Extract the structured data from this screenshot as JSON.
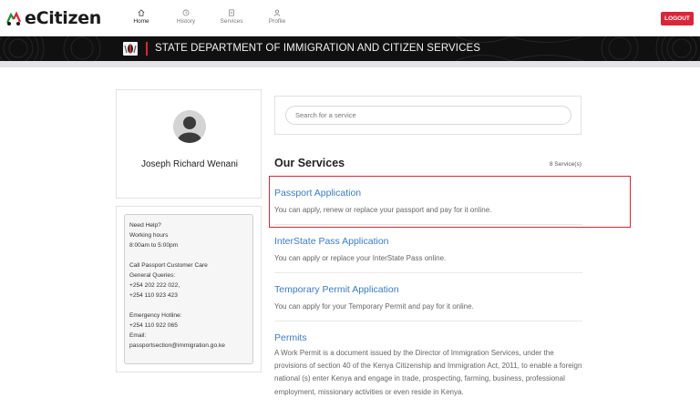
{
  "app": {
    "logo_text": "eCitizen",
    "logout_label": "LOGOUT"
  },
  "nav": {
    "items": [
      {
        "label": "Home",
        "icon": "home-icon"
      },
      {
        "label": "History",
        "icon": "history-icon"
      },
      {
        "label": "Services",
        "icon": "services-icon"
      },
      {
        "label": "Profile",
        "icon": "profile-icon"
      }
    ],
    "active": "Home"
  },
  "banner": {
    "title": "STATE DEPARTMENT OF IMMIGRATION AND CITIZEN SERVICES",
    "emblem_icon": "coat-of-arms-icon"
  },
  "profile": {
    "name": "Joseph Richard Wenani",
    "avatar_icon": "user-avatar-icon"
  },
  "help": {
    "title": "Need Help?",
    "hours_label": "Working hours",
    "hours": "8:00am to 5:00pm",
    "call_label": "Call Passport Customer Care",
    "general_label": "General Queries:",
    "phone1": "+254 202 222 022,",
    "phone2": "+254 110 923 423",
    "emergency_label": "Emergency Hotline:",
    "emergency_phone": "+254 110 922 065",
    "email_label": "Email:",
    "email": "passportsection@immigration.go.ke"
  },
  "search": {
    "placeholder": "Search for a service"
  },
  "services": {
    "title": "Our Services",
    "count": "8 Service(s)",
    "items": [
      {
        "title": "Passport Application",
        "desc": "You can apply, renew or replace your passport and pay for it online."
      },
      {
        "title": "InterState Pass Application",
        "desc": "You can apply or replace your InterState Pass online."
      },
      {
        "title": "Temporary Permit Application",
        "desc": "You can apply for your Temporary Permit and pay for it online."
      },
      {
        "title": "Permits",
        "desc": "A Work Permit is a document issued by the Director of Immigration Services, under the provisions of section 40 of the Kenya Citizenship and Immigration Act, 2011, to enable a foreign national (s) enter Kenya and engage in trade, prospecting, farming, business, professional employment, missionary activities or even reside in Kenya."
      }
    ]
  },
  "colors": {
    "accent_red": "#d9263a",
    "link_blue": "#3a7cc1",
    "banner_bg": "#101010"
  }
}
